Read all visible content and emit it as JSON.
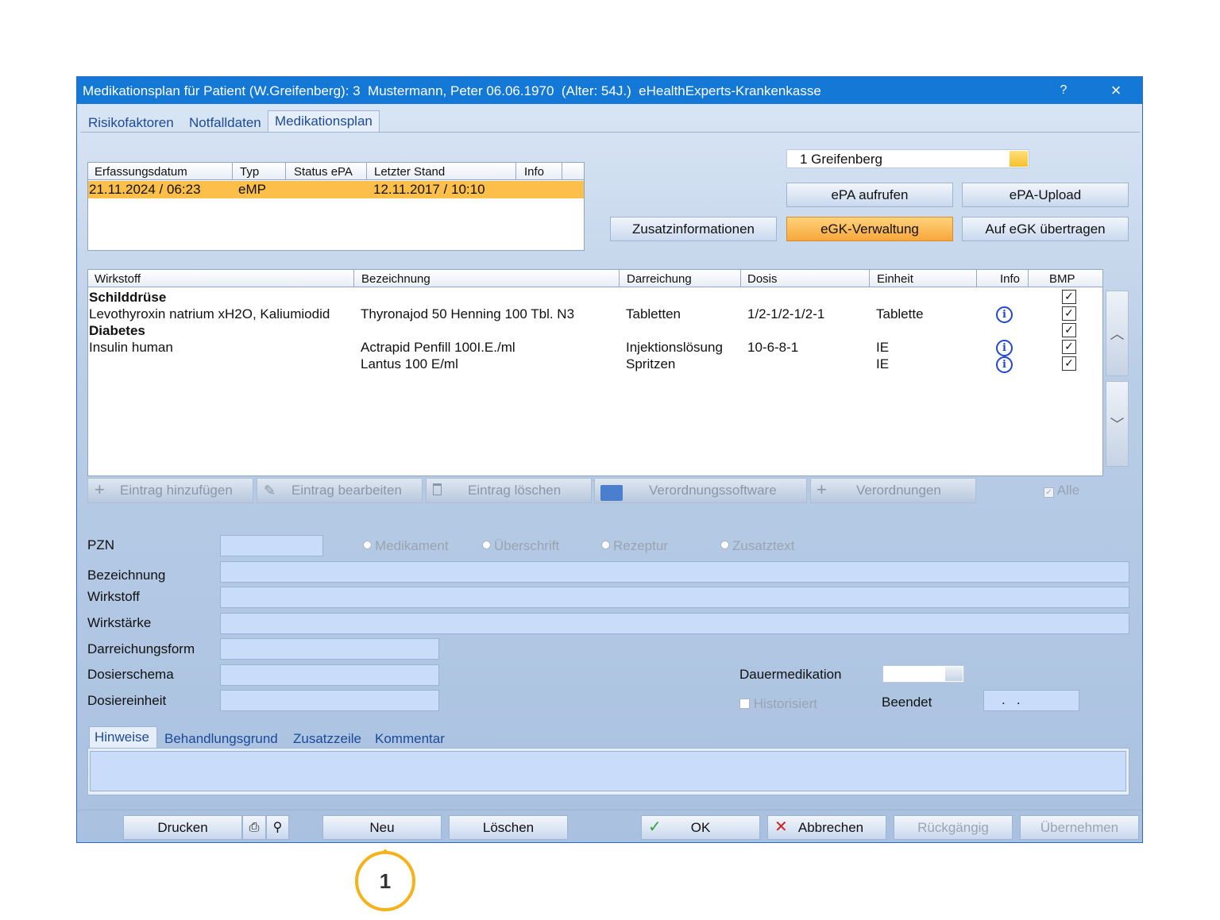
{
  "window": {
    "title": "Medikationsplan für Patient (W.Greifenberg): 3  Mustermann, Peter 06.06.1970  (Alter: 54J.)  eHealthExperts-Krankenkasse",
    "help_label": "?",
    "close_label": "×",
    "accent": "#1378d6"
  },
  "tabs": [
    {
      "label": "Risikofaktoren"
    },
    {
      "label": "Notfalldaten"
    },
    {
      "label": "Medikationsplan",
      "active": true
    }
  ],
  "plans_table": {
    "columns": [
      "Erfassungsdatum",
      "Typ",
      "Status ePA",
      "Letzter Stand",
      "Info"
    ],
    "rows": [
      {
        "erfassungsdatum": "21.11.2024 / 06:23",
        "typ": "eMP",
        "status": "",
        "letzter_stand": "12.11.2017 / 10:10",
        "info": "",
        "selected": true
      }
    ]
  },
  "patient_select": {
    "value": "1 Greifenberg"
  },
  "buttons": {
    "epa_aufrufen": "ePA aufrufen",
    "epa_upload": "ePA-Upload",
    "zusatzinformationen": "Zusatzinformationen",
    "egk_verwaltung": "eGK-Verwaltung",
    "auf_egk": "Auf eGK übertragen"
  },
  "med_table": {
    "columns": [
      "Wirkstoff",
      "Bezeichnung",
      "Darreichung",
      "Dosis",
      "Einheit",
      "Info",
      "BMP"
    ],
    "rows": [
      {
        "wirkstoff": "Schilddrüse",
        "heading": true,
        "bmp": true
      },
      {
        "wirkstoff": "Levothyroxin natrium xH2O, Kaliumiodid",
        "bezeichnung": "Thyronajod 50 Henning 100 Tbl. N3",
        "darreichung": "Tabletten",
        "dosis": "1/2-1/2-1/2-1",
        "einheit": "Tablette",
        "info": true,
        "bmp": true
      },
      {
        "wirkstoff": "Diabetes",
        "heading": true,
        "bmp": true
      },
      {
        "wirkstoff": "Insulin human",
        "bezeichnung": "Actrapid Penfill 100I.E./ml",
        "darreichung": "Injektionslösung",
        "dosis": "10-6-8-1",
        "einheit": "IE",
        "info": true,
        "bmp": true
      },
      {
        "wirkstoff": "",
        "bezeichnung": "Lantus 100 E/ml",
        "darreichung": "Spritzen",
        "dosis": "",
        "einheit": "IE",
        "info": true,
        "bmp": true
      }
    ]
  },
  "toolbar": {
    "add": "Eintrag hinzufügen",
    "edit": "Eintrag bearbeiten",
    "delete": "Eintrag löschen",
    "software": "Verordnungssoftware",
    "verordnungen": "Verordnungen",
    "alle": "Alle"
  },
  "form": {
    "pzn": "PZN",
    "type_options": [
      "Medikament",
      "Überschrift",
      "Rezeptur",
      "Zusatztext"
    ],
    "bezeichnung": "Bezeichnung",
    "wirkstoff": "Wirkstoff",
    "wirkstaerke": "Wirkstärke",
    "darreichungsform": "Darreichungsform",
    "dosierschema": "Dosierschema",
    "dosiereinheit": "Dosiereinheit",
    "dauermedikation": "Dauermedikation",
    "historisiert": "Historisiert",
    "beendet": "Beendet",
    "beendet_value": ".   ."
  },
  "subtabs": [
    {
      "label": "Hinweise",
      "active": true
    },
    {
      "label": "Behandlungsgrund"
    },
    {
      "label": "Zusatzzeile"
    },
    {
      "label": "Kommentar"
    }
  ],
  "footer": {
    "drucken": "Drucken",
    "neu": "Neu",
    "loeschen": "Löschen",
    "ok": "OK",
    "abbrechen": "Abbrechen",
    "rueckgaengig": "Rückgängig",
    "uebernehmen": "Übernehmen"
  },
  "callout": {
    "number": "1",
    "color": "#f5b21c"
  }
}
